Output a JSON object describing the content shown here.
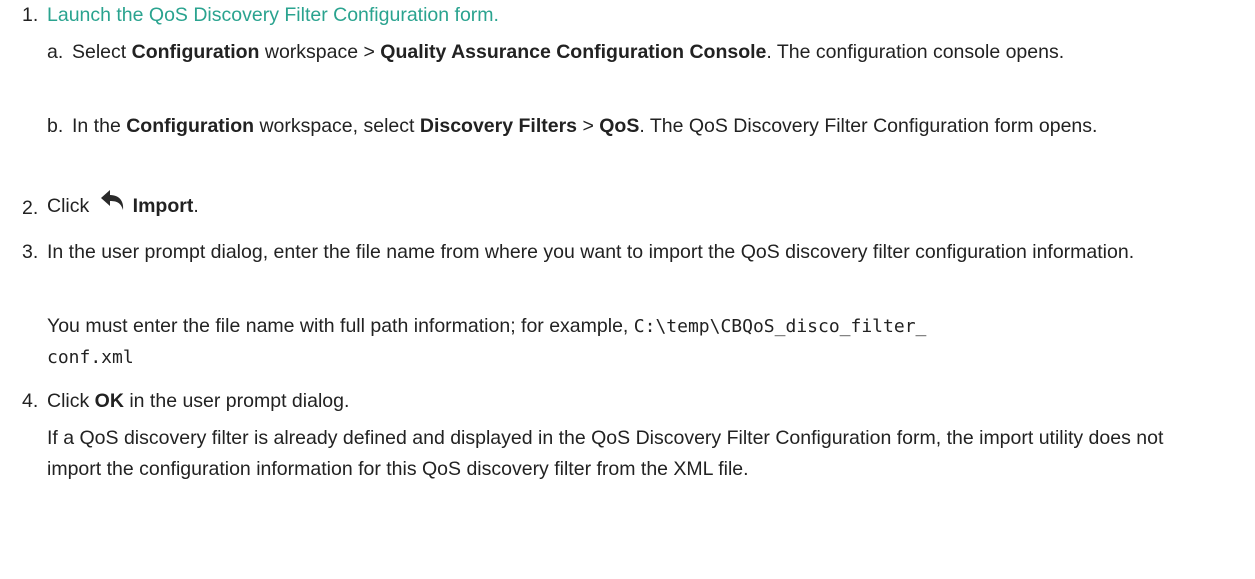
{
  "steps": [
    {
      "number": "1.",
      "link_text": "Launch the QoS Discovery Filter Configuration form.",
      "substeps": [
        {
          "letter": "a.",
          "p1": "Select ",
          "b1": "Configuration",
          "p2": " workspace > ",
          "b2": "Quality Assurance Configuration Console",
          "p3": ". The configuration console opens."
        },
        {
          "letter": "b.",
          "p1": "In the ",
          "b1": "Configuration",
          "p2": " workspace, select ",
          "b2": "Discovery Filters",
          "p3": " > ",
          "b3": "QoS",
          "p4": ". The QoS Discovery Filter Configuration form opens."
        }
      ]
    },
    {
      "number": "2.",
      "p1": "Click ",
      "icon": "import-icon",
      "bold": "Import",
      "p2": "."
    },
    {
      "number": "3.",
      "text": "In the user prompt dialog, enter the file name from where you want to import the QoS discovery filter configuration information.",
      "note_text": "You must enter the file name with full path information; for example, ",
      "code_line1": "C:\\temp\\CBQoS_disco_filter_",
      "code_line2": "conf.xml"
    },
    {
      "number": "4.",
      "p1": "Click ",
      "bold": "OK",
      "p2": " in the user prompt dialog.",
      "note_text": "If a QoS discovery filter is already defined and displayed in the QoS Discovery Filter Configuration form, the import utility does not import the configuration information for this QoS discovery filter from the XML file."
    }
  ]
}
